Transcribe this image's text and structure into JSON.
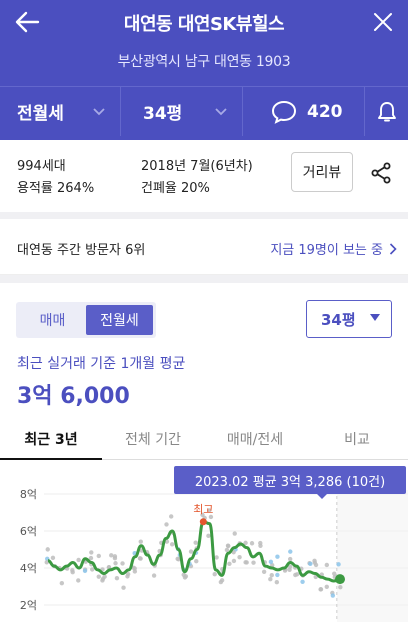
{
  "header": {
    "title": "대연동 대연SK뷰힐스",
    "address": "부산광역시 남구 대연동 1903",
    "filters": {
      "trade_type": "전월세",
      "area": "34평"
    },
    "comment_count": "420"
  },
  "info": {
    "households": "994세대",
    "floor_area_ratio": "용적률 264%",
    "built": "2018년 7월(6년차)",
    "building_coverage": "건폐율 20%",
    "street_view_label": "거리뷰"
  },
  "visitors": {
    "rank": "대연동 주간 방문자 6위",
    "now_viewing": "지금 19명이 보는 중"
  },
  "price": {
    "segments": [
      "매매",
      "전월세"
    ],
    "active_segment": "전월세",
    "size_select": "34평",
    "caption": "최근 실거래 기준 1개월 평균",
    "value": "3억 6,000"
  },
  "tabs": [
    "최근 3년",
    "전체 기간",
    "매매/전세",
    "비교"
  ],
  "chart_data": {
    "type": "line",
    "y_ticks": [
      "8억",
      "6억",
      "4억",
      "2억"
    ],
    "ylim": [
      1.8,
      8.4
    ],
    "tooltip": "2023.02 평균 3억 3,286 (10건)",
    "max_label": "최고",
    "series": [
      {
        "values": [
          4.4,
          4.1,
          3.9,
          4.1,
          4.3,
          4.0,
          4.5,
          4.3,
          3.9,
          3.7,
          3.9,
          4.0,
          3.7,
          3.9,
          4.6,
          5.2,
          4.7,
          4.2,
          4.7,
          5.6,
          6.0,
          5.0,
          3.8,
          4.5,
          5.0,
          6.5,
          6.4,
          3.9,
          3.6,
          4.8,
          5.1,
          5.3,
          5.1,
          4.6,
          4.8,
          4.1,
          4.0,
          3.9,
          4.0,
          4.3,
          4.1,
          3.6,
          3.8,
          3.7,
          3.5,
          3.4,
          3.3,
          3.4
        ]
      }
    ],
    "colors": {
      "line": "#3c9a42",
      "max_point": "#e4572e",
      "scatter_gray": "#bdbdbd",
      "scatter_blue": "#8cc4ea"
    },
    "grid": true
  }
}
